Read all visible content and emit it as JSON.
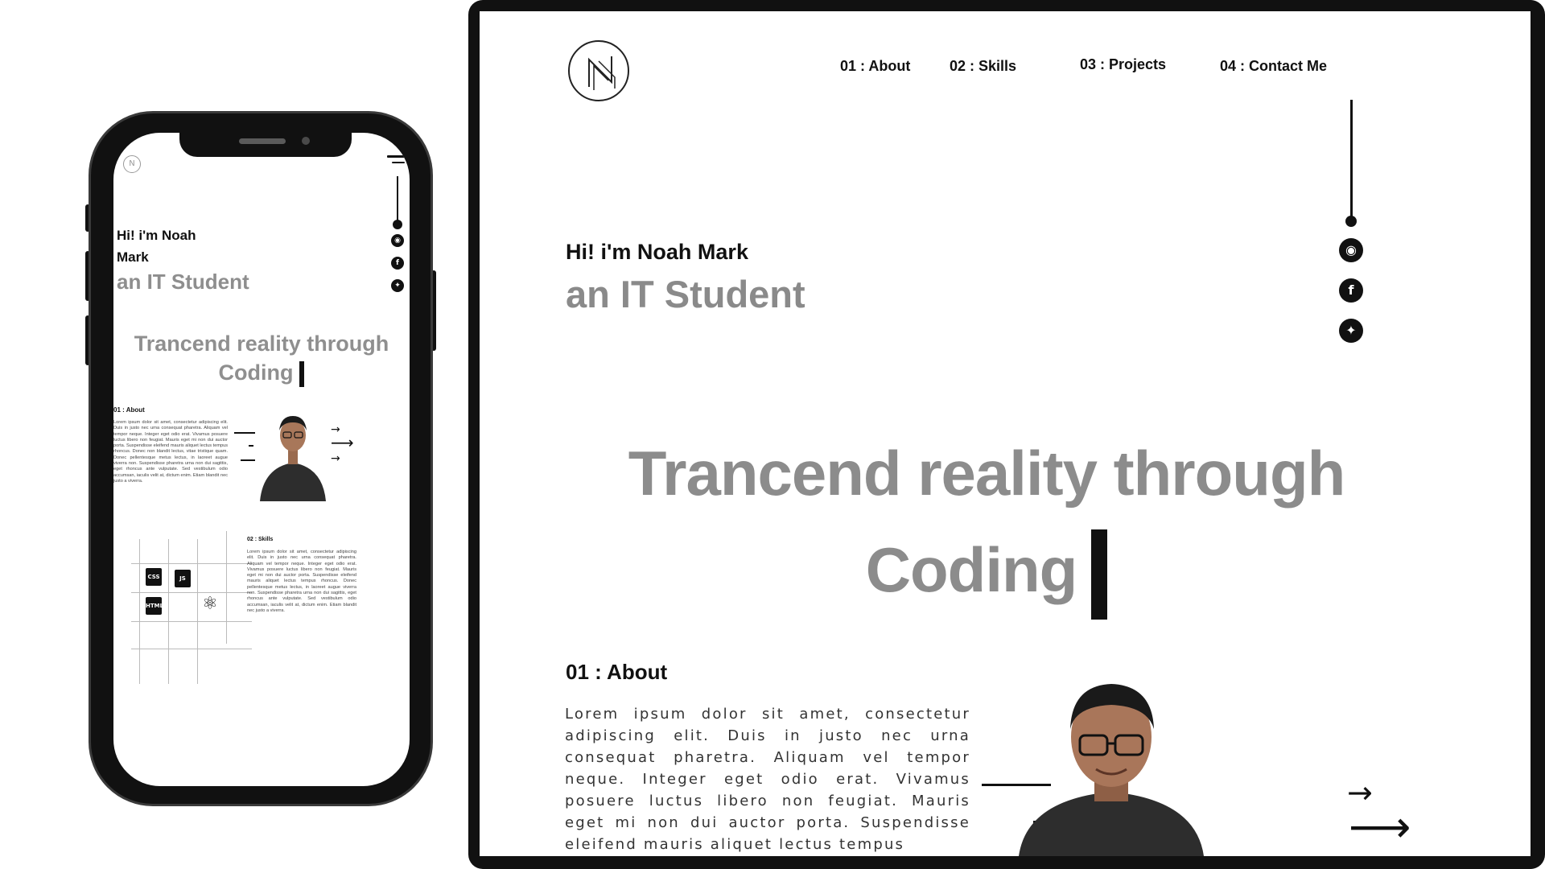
{
  "mobile": {
    "logo_letter": "N",
    "intro_line1": "Hi! i'm Noah",
    "intro_line2": "Mark",
    "role": "an IT Student",
    "tagline_line1": "Trancend reality through",
    "tagline_line2": "Coding",
    "about_heading": "01 : About",
    "about_text": "Lorem ipsum dolor sit amet, consectetur adipiscing elit. Duis in justo nec urna consequat pharetra. Aliquam vel tempor neque. Integer eget odio erat. Vivamus posuere luctus libero non feugiat. Mauris eget mi non dui auctor porta. Suspendisse eleifend mauris aliquet lectus tempus rhoncus. Donec non blandit lectus, vitae tristique quam. Donec pellentesque metus lectus, in laoreet augue viverra non. Suspendisse pharetra urna non dui sagittis, eget rhoncus ante vulputate. Sed vestibulum odio accumsan, iaculis velit at, dictum enim. Etiam blandit nec justo a viverra.",
    "skills_heading": "02 : Skills",
    "skills_text": "Lorem ipsum dolor sit amet, consectetur adipiscing elit. Duis in justo nec urna consequat pharetra. Aliquam vel tempor neque. Integer eget odio erat. Vivamus posuere luctus libero non feugiat. Mauris eget mi non dui auctor porta. Suspendisse eleifend mauris aliquet lectus tempus rhoncus. Donec pellentesque metus lectus, in laoreet augue viverra non. Suspendisse pharetra urna non dui sagittis, eget rhoncus ante vulputate. Sed vestibulum odio accumsan, iaculis velit at, dictum enim. Etiam blandit nec justo a viverra.",
    "skill_icons": [
      {
        "name": "css3-icon",
        "label": "CSS"
      },
      {
        "name": "javascript-icon",
        "label": "JS"
      },
      {
        "name": "html5-icon",
        "label": "HTML"
      },
      {
        "name": "react-icon",
        "label": "⚛"
      }
    ]
  },
  "desktop": {
    "nav": [
      {
        "label": "01 : About"
      },
      {
        "label": "02 : Skills"
      },
      {
        "label": "03 : Projects"
      },
      {
        "label": "04 : Contact Me"
      }
    ],
    "socials": [
      {
        "name": "github-icon",
        "glyph": "◉"
      },
      {
        "name": "facebook-icon",
        "glyph": "f"
      },
      {
        "name": "twitter-icon",
        "glyph": "✦"
      }
    ],
    "intro": "Hi! i'm Noah Mark",
    "role": "an IT Student",
    "tagline_line1": "Trancend reality through",
    "tagline_line2": "Coding",
    "about_heading": "01 : About",
    "about_text": "Lorem ipsum dolor sit amet, consectetur adipiscing elit. Duis in justo nec urna consequat pharetra. Aliquam vel tempor neque. Integer eget odio erat. Vivamus posuere luctus libero non feugiat. Mauris eget mi non dui auctor porta. Suspendisse eleifend mauris aliquet lectus tempus"
  },
  "colors": {
    "ink": "#111111",
    "muted_gray": "#8c8c8c",
    "background": "#ffffff",
    "frame": "#111111"
  }
}
